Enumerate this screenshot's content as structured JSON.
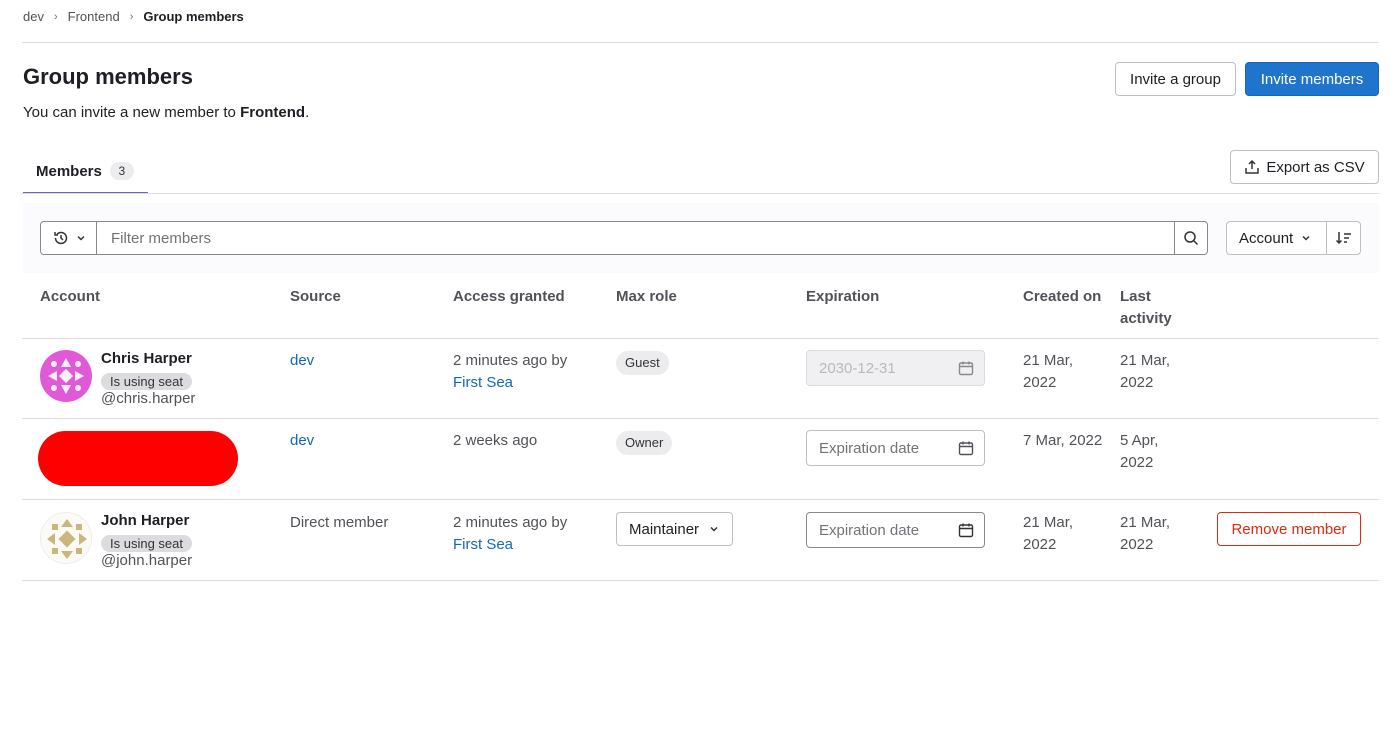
{
  "breadcrumb": {
    "items": [
      "dev",
      "Frontend"
    ],
    "current": "Group members"
  },
  "header": {
    "title": "Group members",
    "description_prefix": "You can invite a new member to ",
    "group_name": "Frontend",
    "description_suffix": ".",
    "invite_group_label": "Invite a group",
    "invite_members_label": "Invite members"
  },
  "tabs": [
    {
      "label": "Members",
      "count": "3"
    }
  ],
  "export_label": "Export as CSV",
  "filter": {
    "placeholder": "Filter members",
    "sort_label": "Account"
  },
  "table": {
    "columns": [
      "Account",
      "Source",
      "Access granted",
      "Max role",
      "Expiration",
      "Created on",
      "Last activity"
    ],
    "rows": [
      {
        "name": "Chris Harper",
        "seat_badge": "Is using seat",
        "username": "@chris.harper",
        "source": "dev",
        "access_granted_text": "2 minutes ago by",
        "access_granted_by": "First Sea",
        "max_role": "Guest",
        "expiration": "2030-12-31",
        "created_on": "21 Mar, 2022",
        "last_activity": "21 Mar, 2022",
        "avatar_color": "#e05ad8"
      },
      {
        "source": "dev",
        "access_granted_text": "2 weeks ago",
        "max_role": "Owner",
        "expiration_placeholder": "Expiration date",
        "created_on": "7 Mar, 2022",
        "last_activity": "5 Apr, 2022"
      },
      {
        "name": "John Harper",
        "seat_badge": "Is using seat",
        "username": "@john.harper",
        "source": "Direct member",
        "access_granted_text": "2 minutes ago by",
        "access_granted_by": "First Sea",
        "max_role": "Maintainer",
        "expiration_placeholder": "Expiration date",
        "created_on": "21 Mar, 2022",
        "last_activity": "21 Mar, 2022",
        "remove_label": "Remove member",
        "avatar_color": "#c9b77e"
      }
    ]
  },
  "colors": {
    "primary": "#1f75cb",
    "danger": "#dd2b0e",
    "link": "#1068bf",
    "tab_underline": "#6666c4"
  }
}
